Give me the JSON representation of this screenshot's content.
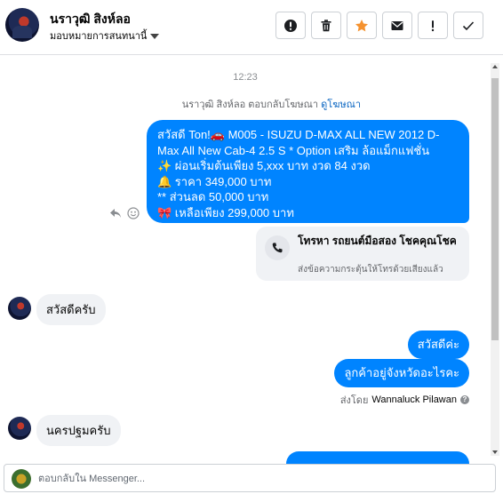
{
  "header": {
    "contact_name": "นราวุฒิ สิงห์ลอ",
    "assign_label": "มอบหมายการสนทนานี้",
    "actions": [
      {
        "name": "alert-button",
        "icon": "exclamation-circle-icon"
      },
      {
        "name": "delete-button",
        "icon": "trash-icon"
      },
      {
        "name": "star-button",
        "icon": "star-icon",
        "color": "#f5922f"
      },
      {
        "name": "email-button",
        "icon": "envelope-icon"
      },
      {
        "name": "spam-button",
        "icon": "exclamation-icon"
      },
      {
        "name": "done-button",
        "icon": "check-icon"
      }
    ]
  },
  "thread": {
    "timestamp": "12:23",
    "ad_reply_text": "นราวุฒิ สิงห์ลอ ตอบกลับโฆษณา",
    "ad_reply_link": "ดูโฆษณา",
    "ad_message": "สวัสดี Ton!🚗 M005 - ISUZU D-MAX ALL NEW 2012 D-Max All New Cab-4 2.5 S  * Option เสริม ล้อแม็กแฟชั่น\n✨ ผ่อนเริ่มต้นเพียง 5,xxx บาท งวด 84 งวด\n🔔 ราคา 349,000 บาท\n** ส่วนลด 50,000 บาท\n🎀 เหลือเพียง 299,000 บาท",
    "call_card": {
      "title": "โทรหา รถยนต์มือสอง โชคคุณโชค",
      "subtitle": "ส่งข้อความกระตุ้นให้โทรด้วยเสียงแล้ว"
    },
    "incoming_1": "สวัสดีครับ",
    "outgoing_1": "สวัสดีค่ะ",
    "outgoing_2": "ลูกค้าอยู่จังหวัดอะไรคะ",
    "sent_by_label": "ส่งโดย",
    "sent_by_name": "Wannaluck Pilawan",
    "incoming_2": "นครปฐมครับ"
  },
  "composer": {
    "placeholder": "ตอบกลับใน Messenger..."
  },
  "colors": {
    "accent": "#0084ff",
    "star": "#f5922f"
  }
}
